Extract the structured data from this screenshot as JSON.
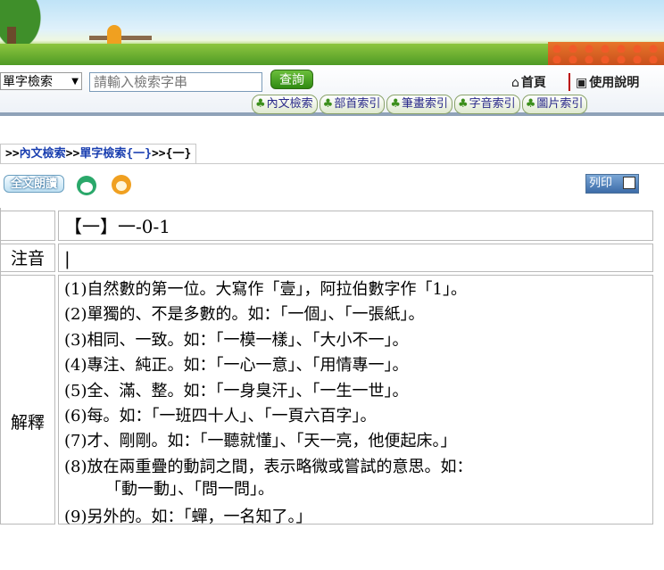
{
  "toolbar": {
    "search_mode": "單字檢索",
    "search_placeholder": "請輸入檢索字串",
    "query_label": "查詢",
    "home_label": "首頁",
    "help_label": "使用說明",
    "nav": [
      "內文檢索",
      "部首索引",
      "筆畫索引",
      "字音索引",
      "圖片索引"
    ]
  },
  "breadcrumb": {
    "sep": ">>",
    "item1": "內文檢索",
    "item2": "單字檢索{一}",
    "current": "{一}"
  },
  "actions": {
    "read_label": "全文朗讀",
    "print_label": "列印"
  },
  "entry": {
    "headword": "【一】一-0-1",
    "zhuyin_label": "注音",
    "zhuyin_value": "|",
    "explain_label": "解釋",
    "definitions": [
      "(1)自然數的第一位。大寫作「壹」，阿拉伯數字作「1」。",
      "(2)單獨的、不是多數的。如：「一個」、「一張紙」。",
      "(3)相同、一致。如：「一模一樣」、「大小不一」。",
      "(4)專注、純正。如：「一心一意」、「用情專一」。",
      "(5)全、滿、整。如：「一身臭汗」、「一生一世」。",
      "(6)每。如：「一班四十人」、「一頁六百字」。",
      "(7)才、剛剛。如：「一聽就懂」、「天一亮，他便起床。」",
      "(8)放在兩重疊的動詞之間，表示略微或嘗試的意思。如：",
      "「動一動」、「問一問」。",
      "(9)另外的。如：「蟬，一名知了。」"
    ]
  }
}
